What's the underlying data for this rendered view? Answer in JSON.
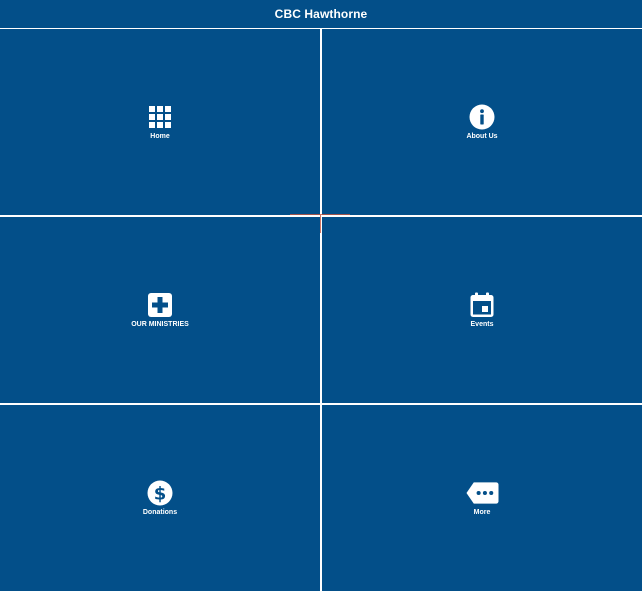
{
  "header": {
    "title": "CBC Hawthorne"
  },
  "tiles": [
    {
      "label": "Home",
      "icon": "grid-icon"
    },
    {
      "label": "About Us",
      "icon": "info-icon"
    },
    {
      "label": "OUR MINISTRIES",
      "icon": "plus-square-icon"
    },
    {
      "label": "Events",
      "icon": "calendar-icon"
    },
    {
      "label": "Donations",
      "icon": "dollar-icon"
    },
    {
      "label": "More",
      "icon": "more-tag-icon"
    }
  ],
  "colors": {
    "tile_background": "#034f89",
    "divider": "#ffffff",
    "icon": "#ffffff"
  }
}
